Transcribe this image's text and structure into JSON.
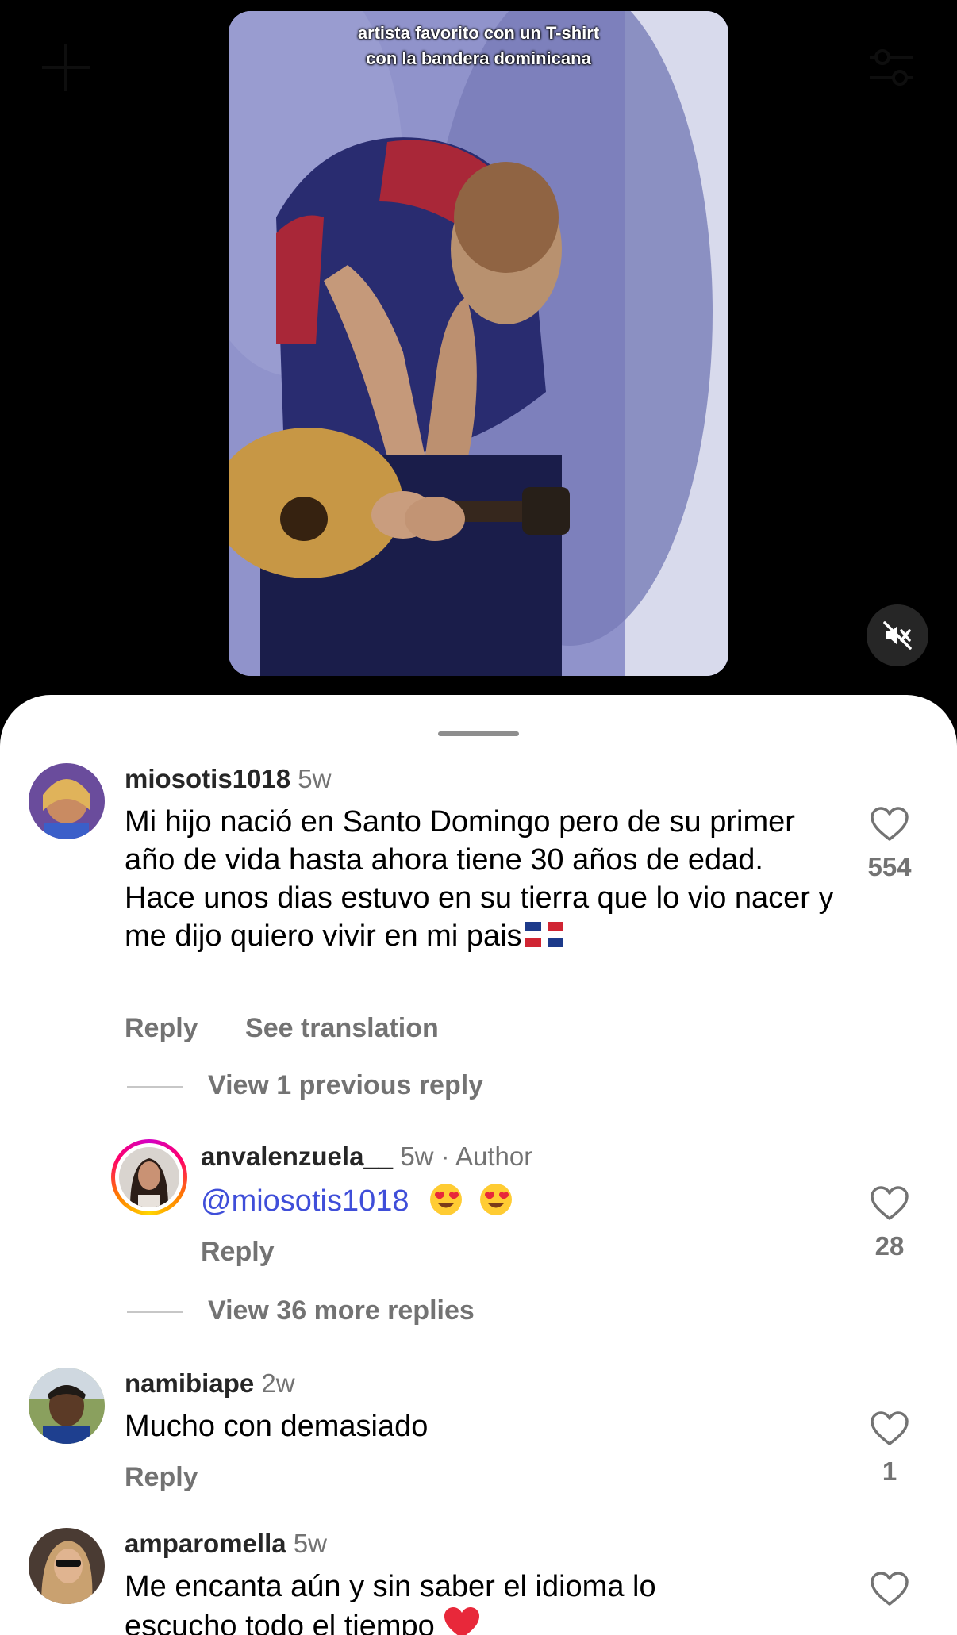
{
  "video": {
    "caption_line1": "artista favorito con un T-shirt",
    "caption_line2": "con la bandera dominicana",
    "mute_icon": "speaker-muted-icon"
  },
  "comments": [
    {
      "username": "miosotis1018",
      "time": "5w",
      "text": "Mi hijo nació en Santo Domingo pero de su primer año de vida hasta ahora tiene 30 años de edad. Hace unos dias estuvo en su tierra que lo vio nacer y me dijo quiero vivir en mi pais",
      "text_emoji": "dominican-flag-emoji",
      "reply_label": "Reply",
      "translate_label": "See translation",
      "likes": "554",
      "thread_link": "View 1 previous reply"
    },
    {
      "username": "anvalenzuela__",
      "time": "5w",
      "author_badge": "· Author",
      "mention": "@miosotis1018",
      "text_emoji": "heart-eyes-emoji",
      "reply_label": "Reply",
      "likes": "28",
      "thread_link": "View 36 more replies"
    },
    {
      "username": "namibiape",
      "time": "2w",
      "text": "Mucho con demasiado",
      "reply_label": "Reply",
      "likes": "1"
    },
    {
      "username": "amparomella",
      "time": "5w",
      "text": "Me encanta aún y sin saber el idioma lo escucho todo el tiempo",
      "text_emoji": "red-heart-emoji"
    }
  ],
  "colors": {
    "mention": "#3f4ed9",
    "secondary_text": "#737373"
  }
}
